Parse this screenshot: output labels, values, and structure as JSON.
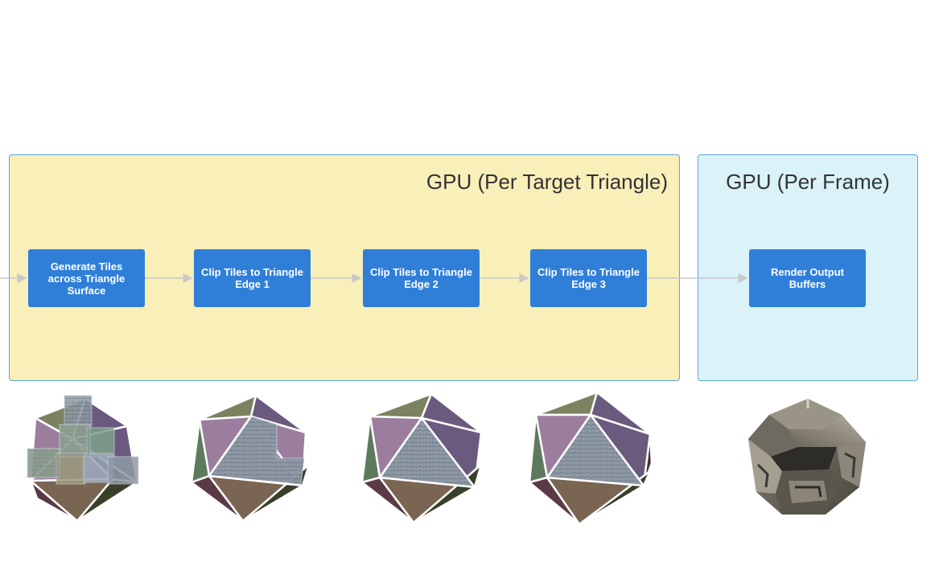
{
  "groups": {
    "per_triangle": {
      "title": "GPU (Per Target Triangle)",
      "color": "#f9efb9",
      "border": "#5ba4d8"
    },
    "per_frame": {
      "title": "GPU (Per Frame)",
      "color": "#d9f3f8",
      "border": "#5ba4d8"
    }
  },
  "steps": {
    "generate": "Generate Tiles across Triangle Surface",
    "clip1": "Clip Tiles to Triangle Edge 1",
    "clip2": "Clip Tiles to Triangle Edge 2",
    "clip3": "Clip Tiles to Triangle Edge 3",
    "render": "Render Output Buffers"
  },
  "colors": {
    "step_fill": "#2f7fd9",
    "connector": "#c8c8c8",
    "face_olive": "#7a8260",
    "face_purple_light": "#9b7e9e",
    "face_purple_dark": "#6a5a7e",
    "face_green": "#5e7a5c",
    "face_brown": "#7a6452",
    "face_maroon": "#5a3a45",
    "face_dark_green": "#3a3f2a",
    "tile_texture": "#7f8fa0"
  },
  "illustrations": [
    {
      "name": "icosahedron-tiles-generated",
      "stage": "generate"
    },
    {
      "name": "icosahedron-clipped-edge-1",
      "stage": "clip1"
    },
    {
      "name": "icosahedron-clipped-edge-2",
      "stage": "clip2"
    },
    {
      "name": "icosahedron-clipped-edge-3",
      "stage": "clip3"
    },
    {
      "name": "rendered-stone-mesh",
      "stage": "render"
    }
  ]
}
